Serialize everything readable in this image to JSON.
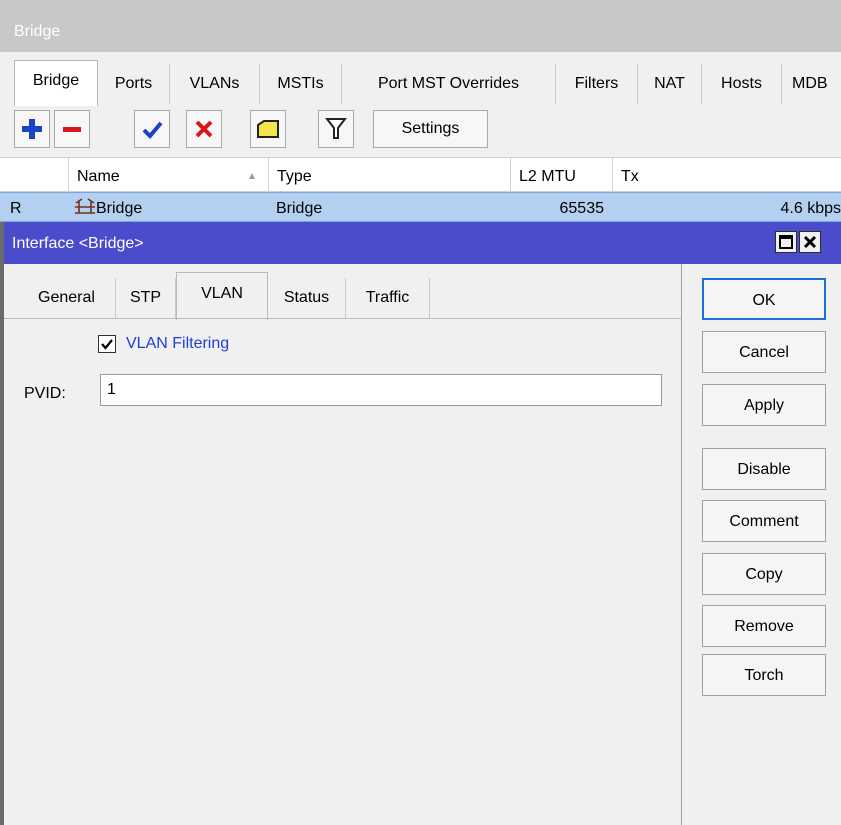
{
  "bridge_window": {
    "title": "Bridge"
  },
  "bridge_tabs": [
    "Bridge",
    "Ports",
    "VLANs",
    "MSTIs",
    "Port MST Overrides",
    "Filters",
    "NAT",
    "Hosts",
    "MDB"
  ],
  "toolbar": {
    "add_icon": "plus-icon",
    "remove_icon": "minus-icon",
    "enable_icon": "check-icon",
    "disable_icon": "cross-icon",
    "comment_icon": "note-icon",
    "filter_icon": "filter-icon",
    "settings_label": "Settings"
  },
  "table": {
    "columns": [
      "Name",
      "Type",
      "L2 MTU",
      "Tx"
    ],
    "row": {
      "flag": "R",
      "name": "Bridge",
      "type": "Bridge",
      "l2mtu": "65535",
      "tx": "4.6 kbps"
    }
  },
  "dialog": {
    "title": "Interface <Bridge>",
    "tabs": [
      "General",
      "STP",
      "VLAN",
      "Status",
      "Traffic"
    ],
    "active_tab": "VLAN",
    "vlan_filtering": {
      "label": "VLAN Filtering",
      "checked": true
    },
    "pvid": {
      "label": "PVID:",
      "value": "1"
    },
    "buttons": [
      "OK",
      "Cancel",
      "Apply",
      "Disable",
      "Comment",
      "Copy",
      "Remove",
      "Torch"
    ]
  },
  "colors": {
    "dialog_title_bar": "#4a4ccc",
    "selected_row": "#b3d0f0",
    "link_text": "#1d3fd6"
  }
}
